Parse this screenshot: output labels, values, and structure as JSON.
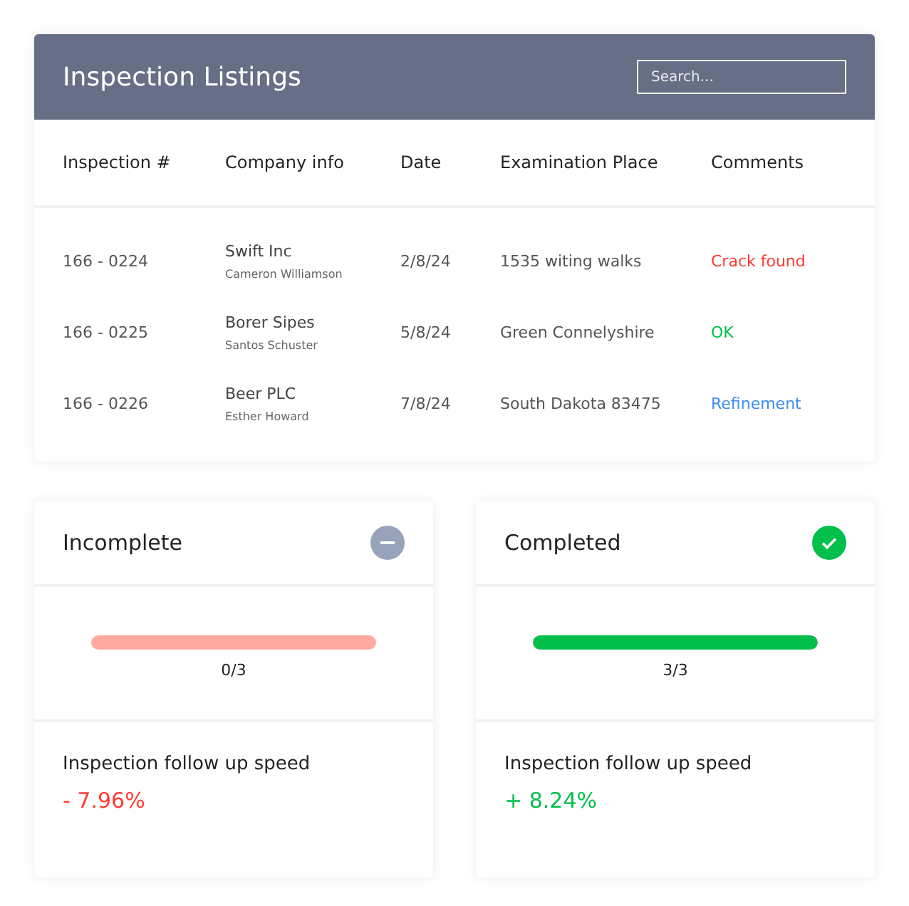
{
  "listing": {
    "title": "Inspection Listings",
    "search": {
      "placeholder": "Search..."
    },
    "columns": [
      "Inspection #",
      "Company info",
      "Date",
      "Examination Place",
      "Comments"
    ],
    "rows": [
      {
        "number": "166 - 0224",
        "company": "Swift Inc",
        "contact": "Cameron Williamson",
        "date": "2/8/24",
        "place": "1535 witing walks",
        "comment": "Crack found",
        "color": "#ff3b30"
      },
      {
        "number": "166 - 0225",
        "company": "Borer Sipes",
        "contact": "Santos Schuster",
        "date": "5/8/24",
        "place": "Green Connelyshire",
        "comment": "OK",
        "color": "#00c04b"
      },
      {
        "number": "166 - 0226",
        "company": "Beer PLC",
        "contact": "Esther Howard",
        "date": "7/8/24",
        "place": "South Dakota 83475",
        "comment": "Refinement",
        "color": "#3d8ef0"
      }
    ]
  },
  "status_cards": [
    {
      "title": "Incomplete",
      "kind": "minus",
      "level": 0,
      "count": "0/3",
      "metric_label": "Inspection follow up speed",
      "metric": "- 7.96%",
      "color": "#ff3b30"
    },
    {
      "title": "Completed",
      "kind": "check",
      "level": 1,
      "count": "3/3",
      "metric_label": "Inspection follow up speed",
      "metric": "+ 8.24%",
      "color": "#00c04b"
    }
  ]
}
